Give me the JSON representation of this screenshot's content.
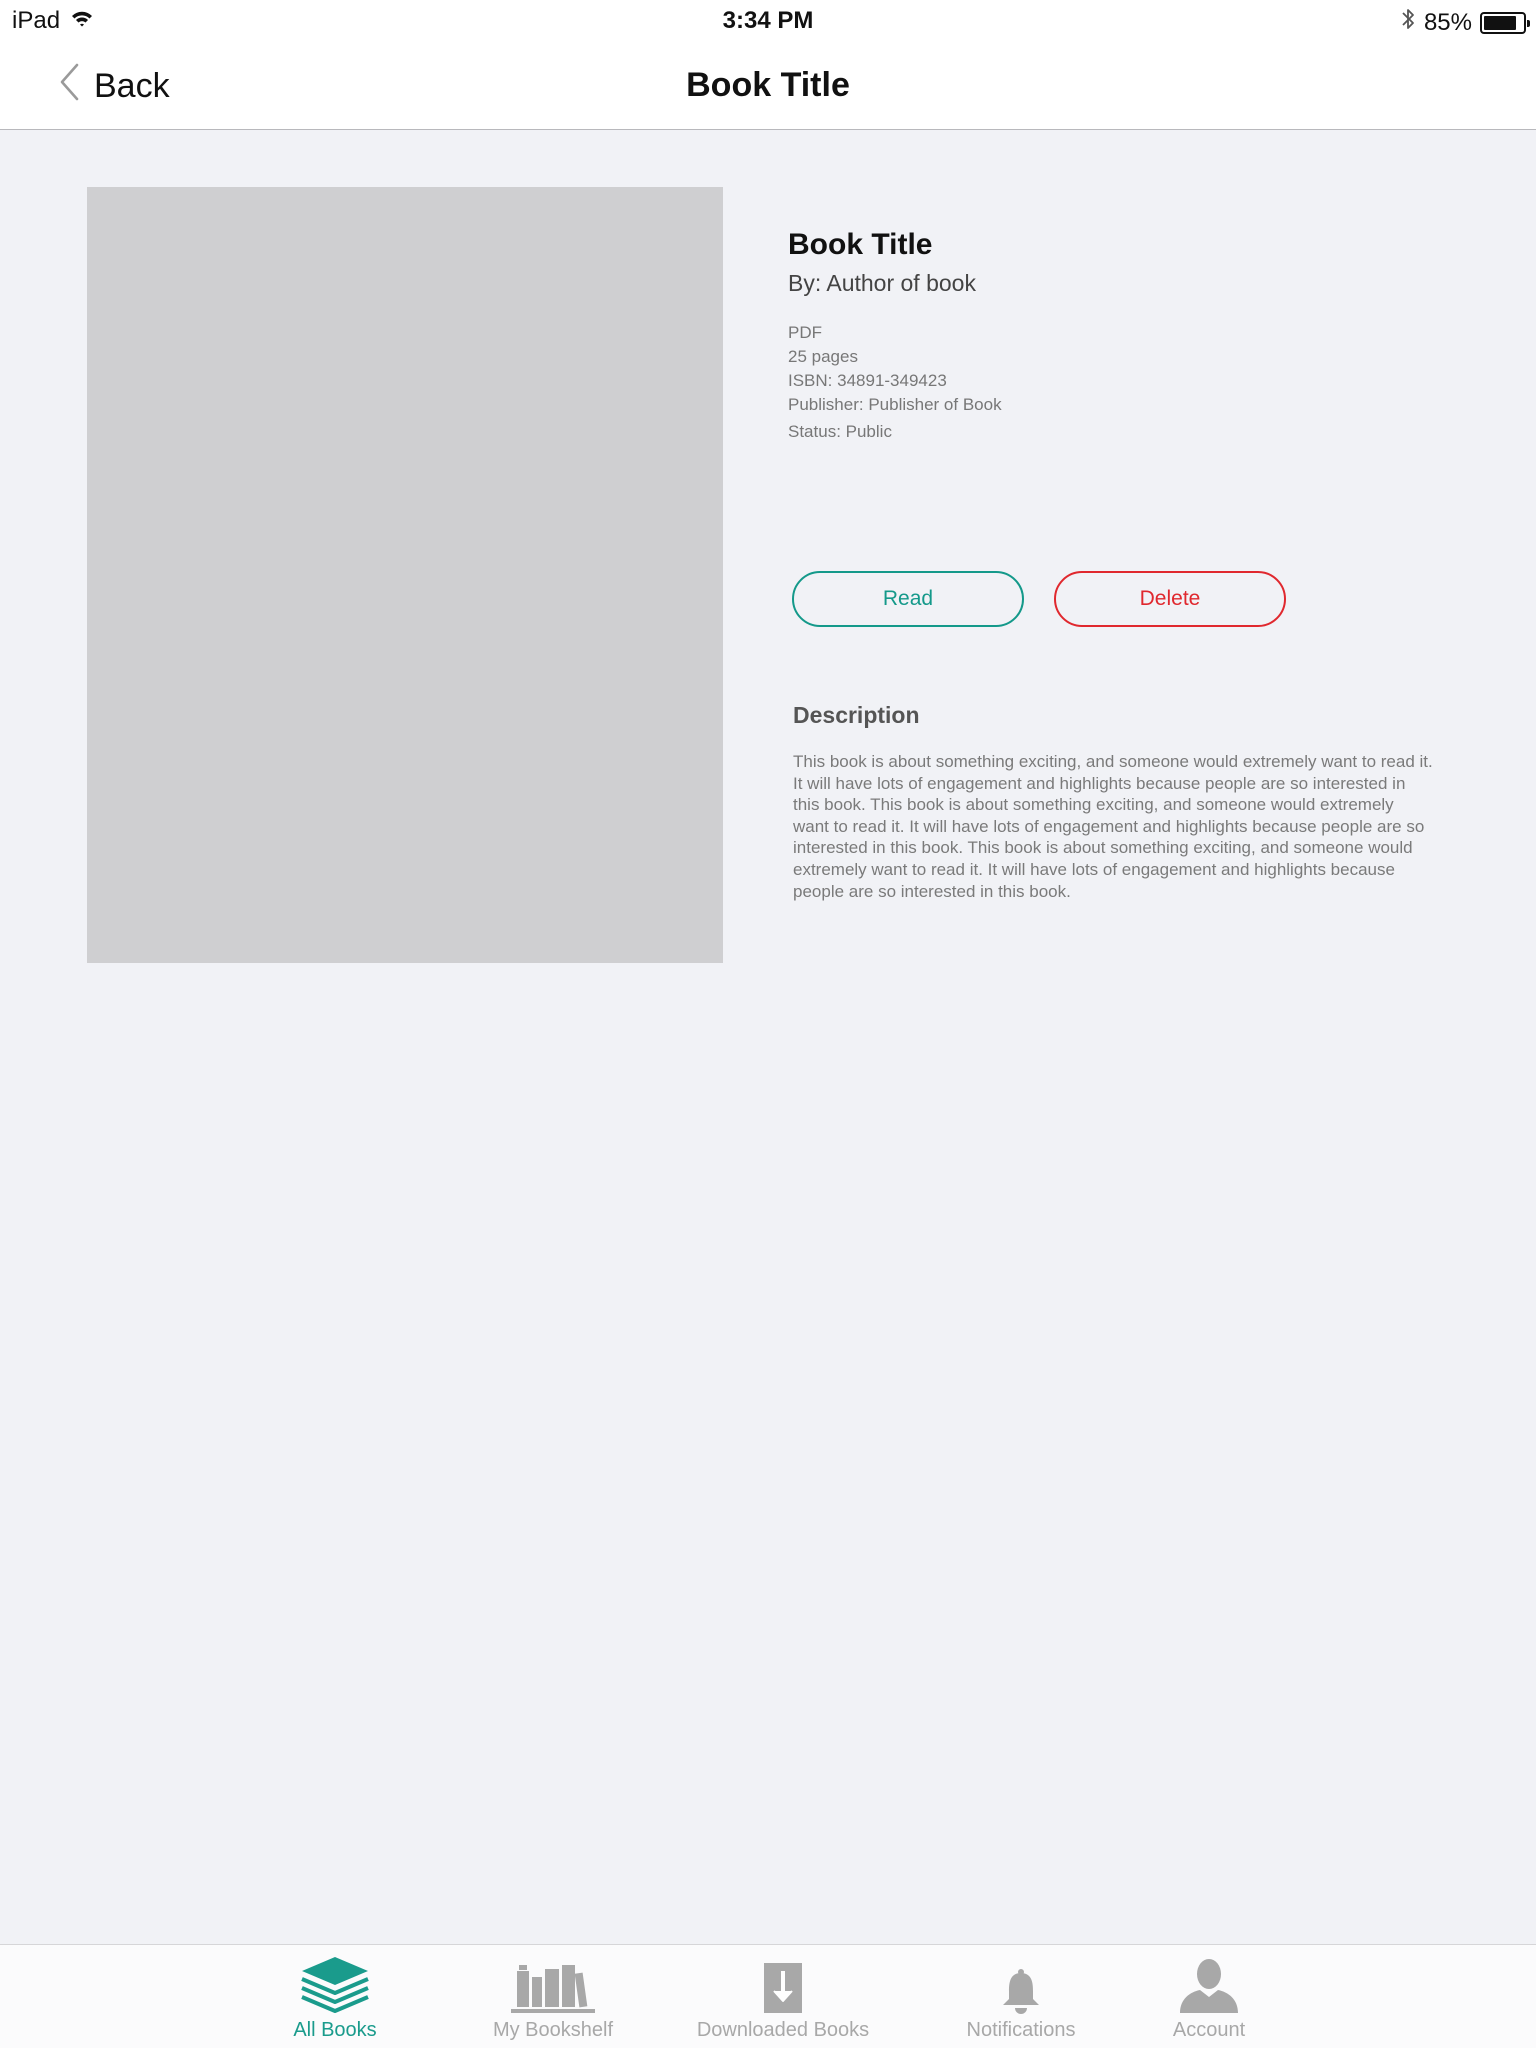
{
  "status_bar": {
    "device": "iPad",
    "time": "3:34 PM",
    "battery": "85%",
    "battery_level": 0.85,
    "icons": [
      "wifi-icon",
      "bluetooth-icon",
      "battery-icon"
    ]
  },
  "nav": {
    "back_label": "Back",
    "title": "Book Title"
  },
  "book": {
    "title": "Book Title",
    "author": "By: Author of book",
    "format": "PDF",
    "pages": "25 pages",
    "isbn": "ISBN: 34891-349423",
    "publisher": "Publisher: Publisher of Book",
    "status": "Status: Public"
  },
  "actions": {
    "read_label": "Read",
    "delete_label": "Delete"
  },
  "description": {
    "heading": "Description",
    "body": "This book is about something exciting, and someone would extremely want to read it. It will have lots of engagement and highlights because people are so interested in this book. This book is about something exciting, and someone would extremely want to read it. It will have lots of engagement and highlights because people are so interested in this book. This book is about something exciting, and someone would extremely want to read it. It will have lots of engagement and highlights because people are so interested in this book."
  },
  "tabs": [
    {
      "label": "All Books",
      "icon": "books-stack-icon",
      "active": true
    },
    {
      "label": "My Bookshelf",
      "icon": "bookshelf-icon",
      "active": false
    },
    {
      "label": "Downloaded Books",
      "icon": "download-icon",
      "active": false
    },
    {
      "label": "Notifications",
      "icon": "bell-icon",
      "active": false
    },
    {
      "label": "Account",
      "icon": "person-icon",
      "active": false
    }
  ],
  "colors": {
    "accent": "#1a9b8c",
    "danger": "#e0282e",
    "inactive": "#a8a8a8",
    "background": "#f1f2f6",
    "placeholder": "#cfcfd1"
  }
}
